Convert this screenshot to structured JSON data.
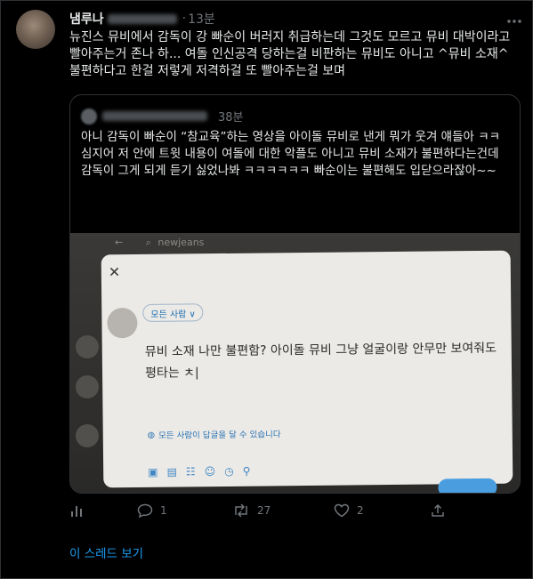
{
  "tweet": {
    "author_name": "냄루나",
    "timestamp": "13분",
    "more_icon": "more-icon",
    "text": "뉴진스 뮤비에서 감독이 강 빠순이 버러지 취급하는데 그것도 모르고 뮤비 대박이라고 빨아주는거 존나 하... 여돌 인신공격 당하는걸 비판하는 뮤비도 아니고 ^뮤비 소재^ 불편하다고 한걸 저렇게 저격하걸 또 빨아주는걸 보며"
  },
  "quote": {
    "timestamp": "38분",
    "text": "아니 감독이 빠순이 “참교육”하는 영상을 아이돌 뮤비로 낸게 뭐가 웃겨 얘들아 ㅋㅋ\n심지어 저 안에 트윗 내용이 여돌에 대한 악플도 아니고 뮤비 소재가 불편하다는건데 감독이 그게 되게 듣기 싫었나봐 ㅋㅋㅋㅋㅋㅋ 빠순이는 불편해도 입닫으라잖아~~",
    "image": {
      "search_text": "newjeans",
      "audience_label": "모든 사람 ∨",
      "compose_text": "뮤비 소재 나만 불편함? 아이돌 뮤비 그냥 얼굴이랑 안무만 보여줘도 평타는 ㅊ|",
      "reply_setting": "모든 사람이 답글을 달 수 있습니다"
    }
  },
  "actions": {
    "reply_count": "1",
    "retweet_count": "27",
    "like_count": "2"
  },
  "thread_link": "이 스레드 보기",
  "colors": {
    "background": "#000000",
    "text": "#e7e9ea",
    "muted": "#71767b",
    "accent": "#1d9bf0",
    "border": "#2f3336"
  }
}
